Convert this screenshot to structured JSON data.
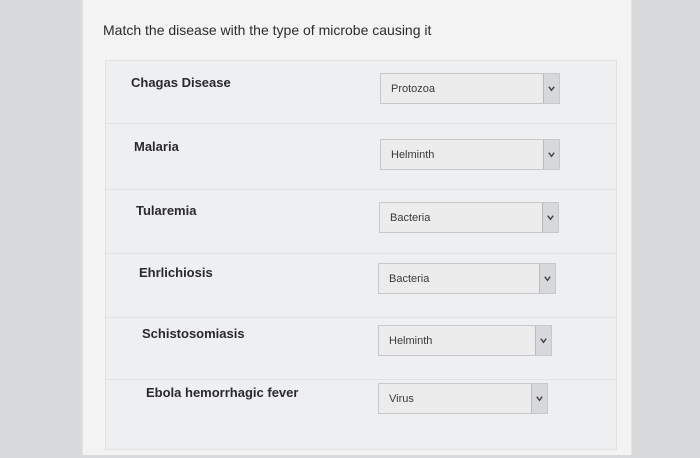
{
  "question": "Match the disease with the type of microbe causing it",
  "rows": [
    {
      "disease": "Chagas Disease",
      "answer": "Protozoa"
    },
    {
      "disease": "Malaria",
      "answer": "Helminth"
    },
    {
      "disease": "Tularemia",
      "answer": "Bacteria"
    },
    {
      "disease": "Ehrlichiosis",
      "answer": "Bacteria"
    },
    {
      "disease": "Schistosomiasis",
      "answer": "Helminth"
    },
    {
      "disease": "Ebola hemorrhagic fever",
      "answer": "Virus"
    }
  ],
  "dropdown_icon": "chevron-down-icon"
}
